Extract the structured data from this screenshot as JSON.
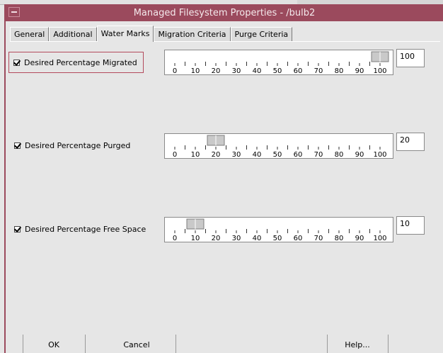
{
  "window": {
    "title": "Managed Filesystem Properties - /bulb2"
  },
  "tabs": [
    {
      "label": "General",
      "active": false
    },
    {
      "label": "Additional",
      "active": false
    },
    {
      "label": "Water Marks",
      "active": true
    },
    {
      "label": "Migration Criteria",
      "active": false
    },
    {
      "label": "Purge Criteria",
      "active": false
    }
  ],
  "scale_ticks": [
    "0",
    "10",
    "20",
    "30",
    "40",
    "50",
    "60",
    "70",
    "80",
    "90",
    "100"
  ],
  "watermarks": [
    {
      "label": "Desired Percentage Migrated",
      "checked": true,
      "value": "100",
      "slider_value": 100
    },
    {
      "label": "Desired Percentage Purged",
      "checked": true,
      "value": "20",
      "slider_value": 20
    },
    {
      "label": "Desired Percentage Free Space",
      "checked": true,
      "value": "10",
      "slider_value": 10
    }
  ],
  "buttons": {
    "ok": "OK",
    "cancel": "Cancel",
    "help": "Help..."
  },
  "colors": {
    "titlebar": "#9b4a5d",
    "background": "#e6e6e6"
  }
}
